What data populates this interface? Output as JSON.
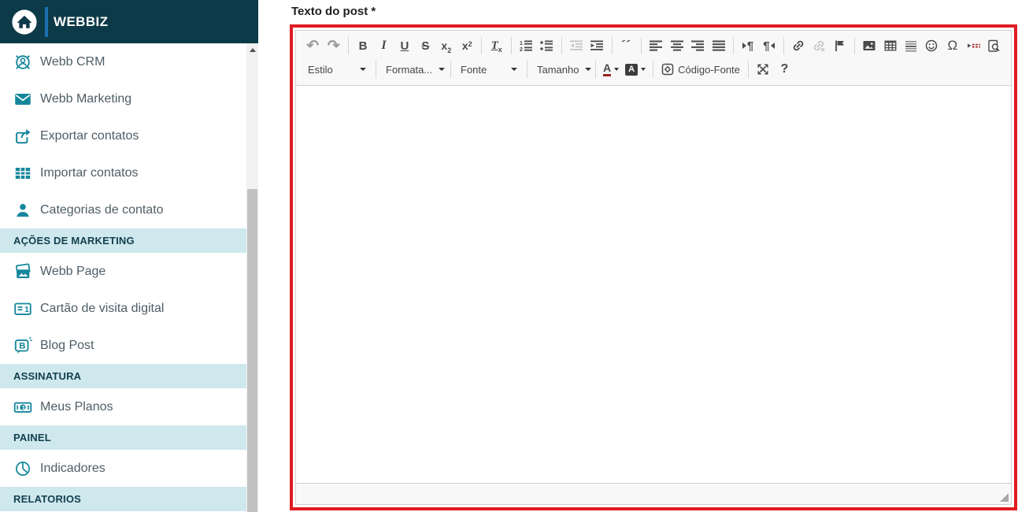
{
  "sidebar": {
    "brand": "WEBBIZ",
    "entries": [
      {
        "type": "item",
        "label": "Webb CRM",
        "icon": "crm-target-person-icon"
      },
      {
        "type": "item",
        "label": "Webb Marketing",
        "icon": "envelope-icon"
      },
      {
        "type": "item",
        "label": "Exportar contatos",
        "icon": "export-arrow-icon"
      },
      {
        "type": "item",
        "label": "Importar contatos",
        "icon": "table-grid-icon"
      },
      {
        "type": "item",
        "label": "Categorias de contato",
        "icon": "person-icon"
      },
      {
        "type": "section",
        "label": "AÇÕES DE MARKETING"
      },
      {
        "type": "item",
        "label": "Webb Page",
        "icon": "photo-stack-icon"
      },
      {
        "type": "item",
        "label": "Cartão de visita digital",
        "icon": "business-card-icon"
      },
      {
        "type": "item",
        "label": "Blog Post",
        "icon": "blog-bubble-icon"
      },
      {
        "type": "section",
        "label": "ASSINATURA"
      },
      {
        "type": "item",
        "label": "Meus Planos",
        "icon": "banknote-icon"
      },
      {
        "type": "section",
        "label": "PAINEL"
      },
      {
        "type": "item",
        "label": "Indicadores",
        "icon": "pie-chart-icon"
      },
      {
        "type": "section",
        "label": "RELATORIOS"
      }
    ],
    "colors": {
      "header_bg": "#0d3a48",
      "accent_bar": "#1b6fae",
      "icon_teal": "#14869c",
      "section_bg": "#cfe8ee"
    }
  },
  "main": {
    "field_label": "Texto do post *"
  },
  "editor": {
    "highlight_border_color": "#e01b22",
    "dropdowns": {
      "style": "Estilo",
      "format": "Formata...",
      "font": "Fonte",
      "size": "Tamanho"
    },
    "source_label": "Código-Fonte",
    "glyphs": {
      "undo": "↶",
      "redo": "↷",
      "bold": "B",
      "italic": "I",
      "underline": "U",
      "strike": "S",
      "sub_base": "x",
      "sub_mark": "2",
      "sup_base": "x",
      "sup_mark": "2",
      "removeformat_base": "T",
      "removeformat_mark": "x",
      "blockquote": "”",
      "bidi": "¶",
      "omega": "Ω",
      "help": "?",
      "text_color": "A",
      "bg_color": "A"
    },
    "toolbar_icons_row1": [
      "undo-icon",
      "redo-icon",
      "bold-icon",
      "italic-icon",
      "underline-icon",
      "strikethrough-icon",
      "subscript-icon",
      "superscript-icon",
      "remove-format-icon",
      "numbered-list-icon",
      "bulleted-list-icon",
      "outdent-icon",
      "indent-icon",
      "blockquote-icon",
      "align-left-icon",
      "align-center-icon",
      "align-right-icon",
      "justify-icon",
      "bidi-ltr-icon",
      "bidi-rtl-icon",
      "link-icon",
      "unlink-icon",
      "anchor-flag-icon",
      "image-icon",
      "table-icon",
      "horizontal-rule-icon",
      "smiley-icon",
      "special-char-icon",
      "page-break-icon",
      "preview-icon"
    ],
    "toolbar_icons_row2": [
      "style-combo",
      "format-combo",
      "font-combo",
      "size-combo",
      "text-color-icon",
      "bg-color-icon",
      "source-code-icon",
      "maximize-icon",
      "help-icon"
    ]
  }
}
